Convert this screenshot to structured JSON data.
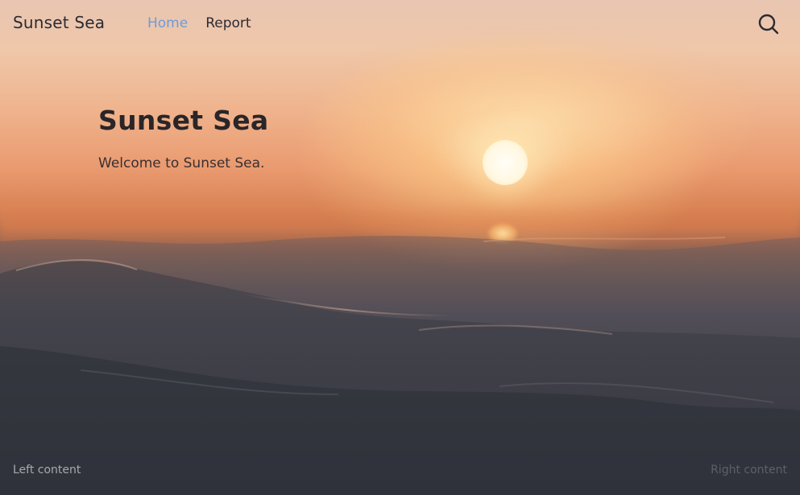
{
  "header": {
    "brand": "Sunset Sea",
    "nav": [
      {
        "label": "Home",
        "active": true
      },
      {
        "label": "Report",
        "active": false
      }
    ],
    "search_icon": "search-icon"
  },
  "hero": {
    "title": "Sunset Sea",
    "subtitle": "Welcome to Sunset Sea."
  },
  "footer": {
    "left": "Left content",
    "right": "Right content"
  },
  "colors": {
    "nav_active": "#6f9bd8",
    "text_dark": "#2b2b33",
    "sky_top": "#e9c6b2",
    "sun_glow": "#ea9a6f",
    "sea": "#33373f"
  }
}
